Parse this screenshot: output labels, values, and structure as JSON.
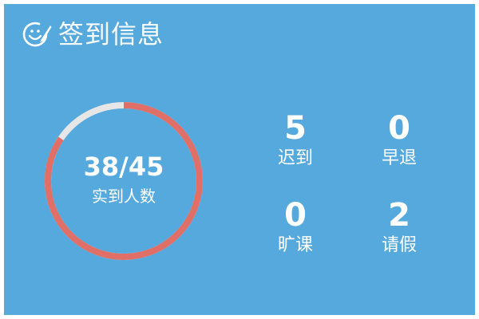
{
  "header": {
    "icon": "smiley-pen-icon",
    "title": "签到信息"
  },
  "summary": {
    "actual": 38,
    "total": 45,
    "ratio_text": "38/45",
    "label": "实到人数"
  },
  "stats": [
    {
      "key": "late",
      "value": "5",
      "label": "迟到"
    },
    {
      "key": "early_leave",
      "value": "0",
      "label": "早退"
    },
    {
      "key": "absent",
      "value": "0",
      "label": "旷课"
    },
    {
      "key": "leave",
      "value": "2",
      "label": "请假"
    }
  ],
  "colors": {
    "background": "#55a9dc",
    "ring_filled": "#e06f68",
    "ring_empty": "#e6e6e6",
    "text": "#ffffff"
  }
}
